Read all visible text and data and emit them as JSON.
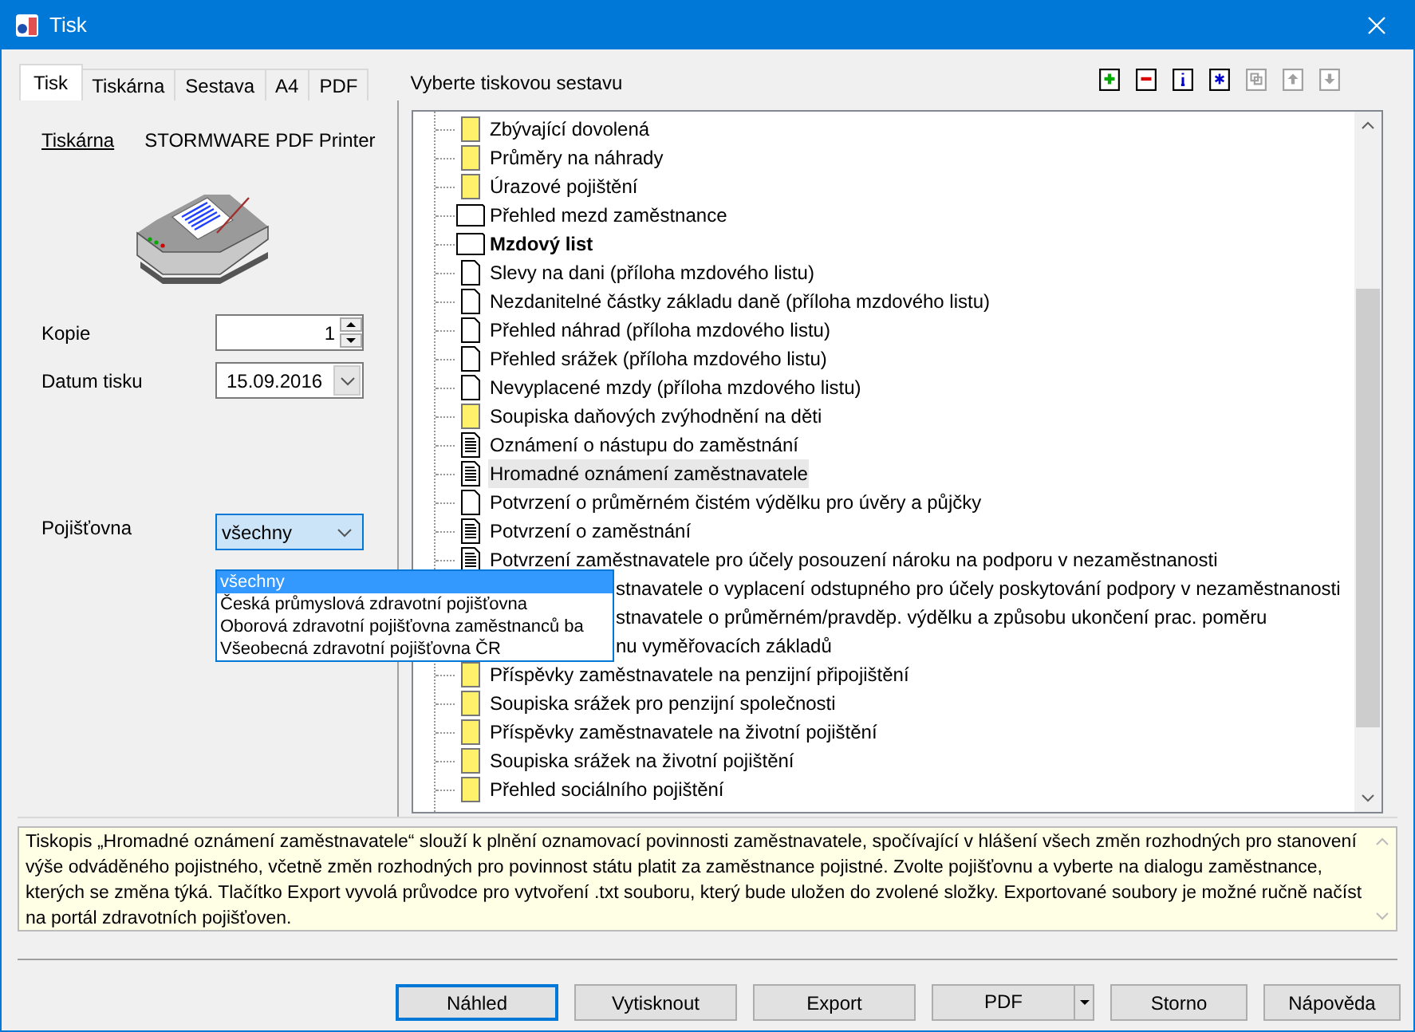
{
  "window": {
    "title": "Tisk"
  },
  "tabs": [
    {
      "label": "Tisk",
      "selected": true
    },
    {
      "label": "Tiskárna",
      "selected": false
    },
    {
      "label": "Sestava",
      "selected": false
    },
    {
      "label": "A4",
      "selected": false
    },
    {
      "label": "PDF",
      "selected": false
    }
  ],
  "report_heading": "Vyberte tiskovou sestavu",
  "toolbar": [
    {
      "kind": "add",
      "disabled": false
    },
    {
      "kind": "remove",
      "disabled": false
    },
    {
      "kind": "info",
      "disabled": false
    },
    {
      "kind": "star",
      "disabled": false
    },
    {
      "kind": "copy",
      "disabled": true
    },
    {
      "kind": "up",
      "disabled": true
    },
    {
      "kind": "down",
      "disabled": true
    }
  ],
  "printer": {
    "label": "Tiskárna",
    "name": "STORMWARE PDF Printer"
  },
  "copies": {
    "label": "Kopie",
    "value": "1"
  },
  "print_date": {
    "label": "Datum tisku",
    "value": "15.09.2016"
  },
  "insurer": {
    "label": "Pojišťovna",
    "value": "všechny",
    "options": [
      {
        "label": "všechny",
        "selected": true
      },
      {
        "label": "Česká průmyslová zdravotní pojišťovna",
        "selected": false
      },
      {
        "label": "Oborová zdravotní pojišťovna zaměstnanců ba",
        "selected": false
      },
      {
        "label": "Všeobecná zdravotní pojišťovna ČR",
        "selected": false
      }
    ]
  },
  "reports": [
    {
      "label": "Zbývající dovolená",
      "kind": "yellow",
      "bold": false,
      "selected": false
    },
    {
      "label": "Průměry na náhrady",
      "kind": "yellow",
      "bold": false,
      "selected": false
    },
    {
      "label": "Úrazové pojištění",
      "kind": "yellow",
      "bold": false,
      "selected": false
    },
    {
      "label": "Přehled mezd zaměstnance",
      "kind": "wide",
      "bold": false,
      "selected": false
    },
    {
      "label": "Mzdový list",
      "kind": "wide",
      "bold": true,
      "selected": false
    },
    {
      "label": "Slevy na dani (příloha mzdového listu)",
      "kind": "page",
      "bold": false,
      "selected": false
    },
    {
      "label": "Nezdanitelné částky základu daně (příloha mzdového listu)",
      "kind": "page",
      "bold": false,
      "selected": false
    },
    {
      "label": "Přehled náhrad (příloha mzdového listu)",
      "kind": "page",
      "bold": false,
      "selected": false
    },
    {
      "label": "Přehled srážek (příloha mzdového listu)",
      "kind": "page",
      "bold": false,
      "selected": false
    },
    {
      "label": "Nevyplacené mzdy (příloha mzdového listu)",
      "kind": "page",
      "bold": false,
      "selected": false
    },
    {
      "label": "Soupiska daňových zvýhodnění na děti",
      "kind": "yellow",
      "bold": false,
      "selected": false
    },
    {
      "label": "Oznámení o nástupu do zaměstnání",
      "kind": "text",
      "bold": false,
      "selected": false
    },
    {
      "label": "Hromadné oznámení zaměstnavatele",
      "kind": "text",
      "bold": false,
      "selected": true
    },
    {
      "label": "Potvrzení o průměrném čistém výdělku pro úvěry a půjčky",
      "kind": "page",
      "bold": false,
      "selected": false
    },
    {
      "label": "Potvrzení o zaměstnání",
      "kind": "text",
      "bold": false,
      "selected": false
    },
    {
      "label": "Potvrzení zaměstnavatele pro účely posouzení nároku na podporu v nezaměstnanosti",
      "kind": "text",
      "bold": false,
      "selected": false
    },
    {
      "label": "stnavatele o vyplacení odstupného pro účely poskytování podpory v nezaměstnanosti",
      "kind": "covered",
      "bold": false,
      "selected": false
    },
    {
      "label": "stnavatele o průměrném/pravděp. výdělku a způsobu ukončení prac. poměru",
      "kind": "covered",
      "bold": false,
      "selected": false
    },
    {
      "label": "nu vyměřovacích základů",
      "kind": "covered",
      "bold": false,
      "selected": false
    },
    {
      "label": "Příspěvky zaměstnavatele na penzijní připojištění",
      "kind": "yellow",
      "bold": false,
      "selected": false
    },
    {
      "label": "Soupiska srážek pro penzijní společnosti",
      "kind": "yellow",
      "bold": false,
      "selected": false
    },
    {
      "label": "Příspěvky zaměstnavatele na životní pojištění",
      "kind": "yellow",
      "bold": false,
      "selected": false
    },
    {
      "label": "Soupiska srážek na životní pojištění",
      "kind": "yellow",
      "bold": false,
      "selected": false
    },
    {
      "label": "Přehled sociálního pojištění",
      "kind": "yellow",
      "bold": false,
      "selected": false
    }
  ],
  "description": "Tiskopis „Hromadné oznámení zaměstnavatele“ slouží k plnění oznamovací povinnosti zaměstnavatele, spočívající v hlášení všech změn rozhodných pro stanovení výše odváděného pojistného, včetně změn rozhodných pro povinnost státu platit za zaměstnance pojistné. Zvolte pojišťovnu a vyberte na dialogu zaměstnance, kterých se změna týká. Tlačítko Export vyvolá průvodce pro vytvoření .txt souboru, který bude uložen do zvolené složky. Exportované soubory je možné ručně načíst na portál zdravotních pojišťoven.",
  "buttons": [
    {
      "label": "Náhled",
      "kind": "focused"
    },
    {
      "label": "Vytisknout",
      "kind": "plain"
    },
    {
      "label": "Export",
      "kind": "plain"
    },
    {
      "label": "PDF",
      "kind": "split"
    },
    {
      "label": "Storno",
      "kind": "plain"
    },
    {
      "label": "Nápověda",
      "kind": "plain"
    }
  ]
}
